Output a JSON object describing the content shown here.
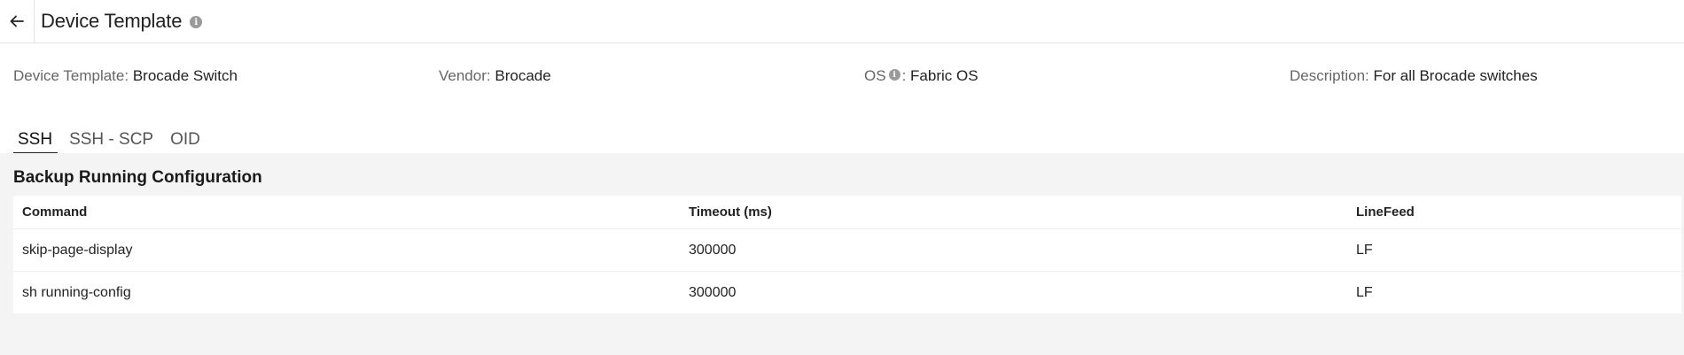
{
  "header": {
    "back_icon": "arrow-left-icon",
    "title": "Device Template",
    "info_icon": "info-icon"
  },
  "details": {
    "template": {
      "label": "Device Template",
      "value": "Brocade Switch"
    },
    "vendor": {
      "label": "Vendor",
      "value": "Brocade"
    },
    "os": {
      "label": "OS",
      "value": "Fabric OS"
    },
    "description": {
      "label": "Description",
      "value": "For all Brocade switches"
    }
  },
  "tabs": [
    {
      "label": "SSH",
      "active": true
    },
    {
      "label": "SSH - SCP",
      "active": false
    },
    {
      "label": "OID",
      "active": false
    }
  ],
  "section": {
    "title": "Backup Running Configuration",
    "columns": [
      "Command",
      "Timeout (ms)",
      "LineFeed"
    ],
    "rows": [
      [
        "skip-page-display",
        "300000",
        "LF"
      ],
      [
        "sh running-config",
        "300000",
        "LF"
      ]
    ]
  }
}
